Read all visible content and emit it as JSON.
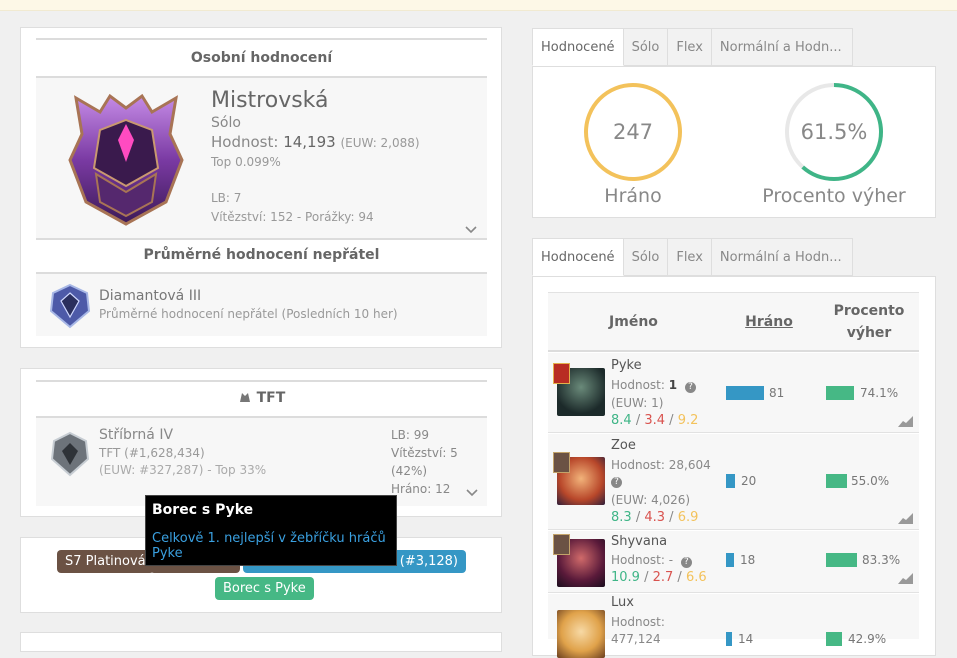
{
  "personal": {
    "title": "Osobní hodnocení",
    "tier": "Mistrovská",
    "queue": "Sólo",
    "lp_label": "Hodnost:",
    "lp_value": "14,193",
    "euw": "(EUW: 2,088)",
    "top": "Top 0.099%",
    "lb": "LB: 7",
    "wl": "Vítězství: 152 - Porážky: 94"
  },
  "opponents": {
    "title": "Průměrné hodnocení nepřátel",
    "tier": "Diamantová III",
    "subtitle": "Průměrné hodnocení nepřátel (Posledních 10 her)"
  },
  "tft": {
    "title": "TFT",
    "tier": "Stříbrná IV",
    "rank": "TFT (#1,628,434)",
    "euw": "(EUW: #327,287) - Top 33%",
    "lb": "LB: 99",
    "wins": "Vítězství: 5",
    "wins_pct": "(42%)",
    "played": "Hráno: 12"
  },
  "tooltip": {
    "title": "Borec s Pyke",
    "body": "Celkově 1. nejlepší v žebříčku hráčů Pyke"
  },
  "badges": {
    "s7": "S7 Platinová",
    "blue": "ů (#3,128)",
    "pyke": "Borec s Pyke"
  },
  "tabs1": [
    "Hodnocené",
    "Sólo",
    "Flex",
    "Normální a Hodn..."
  ],
  "tabs2": [
    "Hodnocené",
    "Sólo",
    "Flex",
    "Normální a Hodn..."
  ],
  "stats": {
    "played_value": "247",
    "played_label": "Hráno",
    "win_value": "61.5%",
    "win_fraction": 0.615,
    "win_label": "Procento výher"
  },
  "colors": {
    "yellow": "#f3c25b",
    "green": "#3fb587",
    "blue": "#3597c5",
    "brown": "#6b5244",
    "badge_green": "#46b885"
  },
  "table": {
    "col_name": "Jméno",
    "col_played": "Hráno",
    "col_win_1": "Procento",
    "col_win_2": "výher",
    "rows": [
      {
        "name": "Pyke",
        "rank_label": "Hodnost:",
        "rank_value": "1",
        "euw": "(EUW: 1)",
        "k": "8.4",
        "d": "3.4",
        "a": "9.2",
        "played": "81",
        "winrate": "74.1%"
      },
      {
        "name": "Zoe",
        "rank_label": "Hodnost:",
        "rank_value": "28,604",
        "euw": "(EUW: 4,026)",
        "k": "8.3",
        "d": "4.3",
        "a": "6.9",
        "played": "20",
        "winrate": "55.0%"
      },
      {
        "name": "Shyvana",
        "rank_label": "Hodnost:",
        "rank_value": "-",
        "euw": "",
        "k": "10.9",
        "d": "2.7",
        "a": "6.6",
        "played": "18",
        "winrate": "83.3%"
      },
      {
        "name": "Lux",
        "rank_label": "Hodnost:",
        "rank_value": "477,124",
        "euw": "",
        "k": "",
        "d": "",
        "a": "",
        "played": "14",
        "winrate": "42.9%"
      }
    ]
  }
}
